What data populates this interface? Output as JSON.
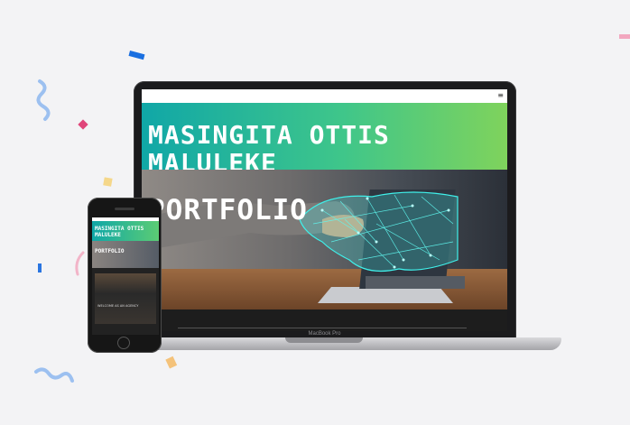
{
  "laptop": {
    "brand_label": "MacBook Pro",
    "site": {
      "menu_icon": "hamburger-menu-icon",
      "hero_title": "MASINGITA OTTIS MALULEKE",
      "section_title": "PORTFOLIO"
    }
  },
  "phone": {
    "site": {
      "hero_title": "MASINGITA OTTIS MALULEKE",
      "section_title": "PORTFOLIO",
      "screenshot_caption": "WELCOME AS AN AGENCY"
    }
  },
  "colors": {
    "hero_gradient_start": "#10a7a7",
    "hero_gradient_end": "#7fd35c",
    "hologram_cyan": "#3ff0ea",
    "page_background": "#f3f3f5"
  }
}
